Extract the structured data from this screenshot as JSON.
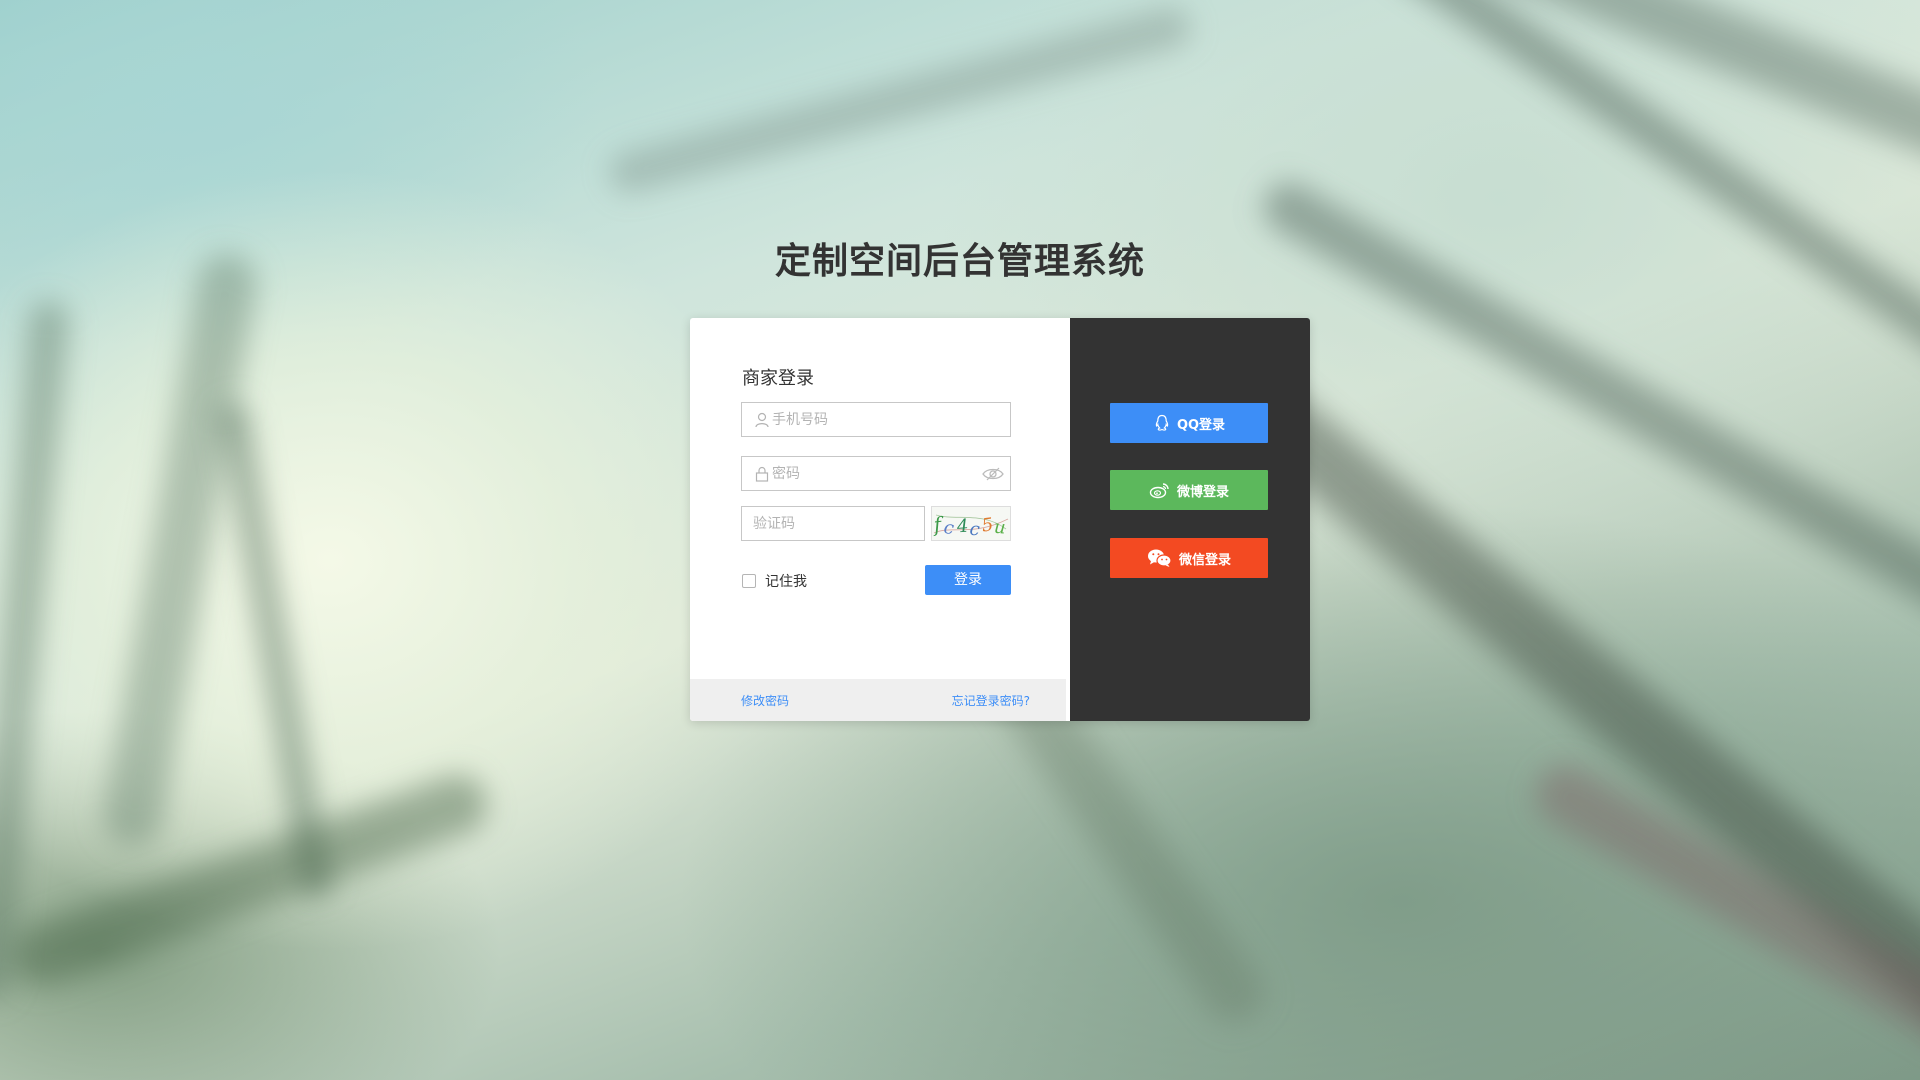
{
  "page": {
    "title": "定制空间后台管理系统"
  },
  "login": {
    "panel_title": "商家登录",
    "phone_placeholder": "手机号码",
    "password_placeholder": "密码",
    "captcha_placeholder": "验证码",
    "captcha_text": "fc4c5u",
    "remember_label": "记住我",
    "submit_label": "登录",
    "change_password_link": "修改密码",
    "forgot_password_link": "忘记登录密码?"
  },
  "social": {
    "qq": {
      "label": "QQ登录",
      "color": "#3d8ef7",
      "icon": "qq-icon"
    },
    "weibo": {
      "label": "微博登录",
      "color": "#5cb85c",
      "icon": "weibo-icon"
    },
    "wechat": {
      "label": "微信登录",
      "color": "#f34a22",
      "icon": "wechat-icon"
    }
  },
  "colors": {
    "accent": "#3d8ef7",
    "right_panel_bg": "#333333"
  }
}
